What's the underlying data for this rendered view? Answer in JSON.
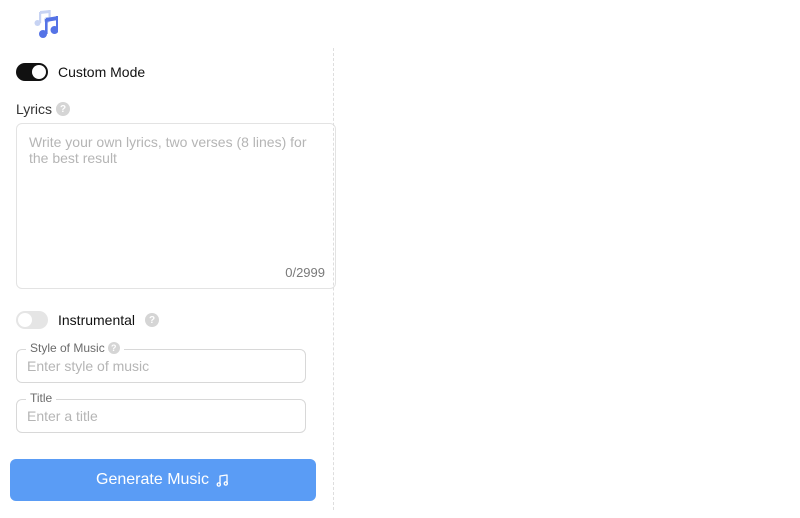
{
  "customMode": {
    "label": "Custom Mode",
    "on": true
  },
  "lyrics": {
    "label": "Lyrics",
    "placeholder": "Write your own lyrics, two verses (8 lines) for the best result",
    "value": "",
    "counter": "0/2999"
  },
  "instrumental": {
    "label": "Instrumental",
    "on": false
  },
  "style": {
    "label": "Style of Music",
    "placeholder": "Enter style of music",
    "value": ""
  },
  "title": {
    "label": "Title",
    "placeholder": "Enter a title",
    "value": ""
  },
  "generateLabel": "Generate Music"
}
